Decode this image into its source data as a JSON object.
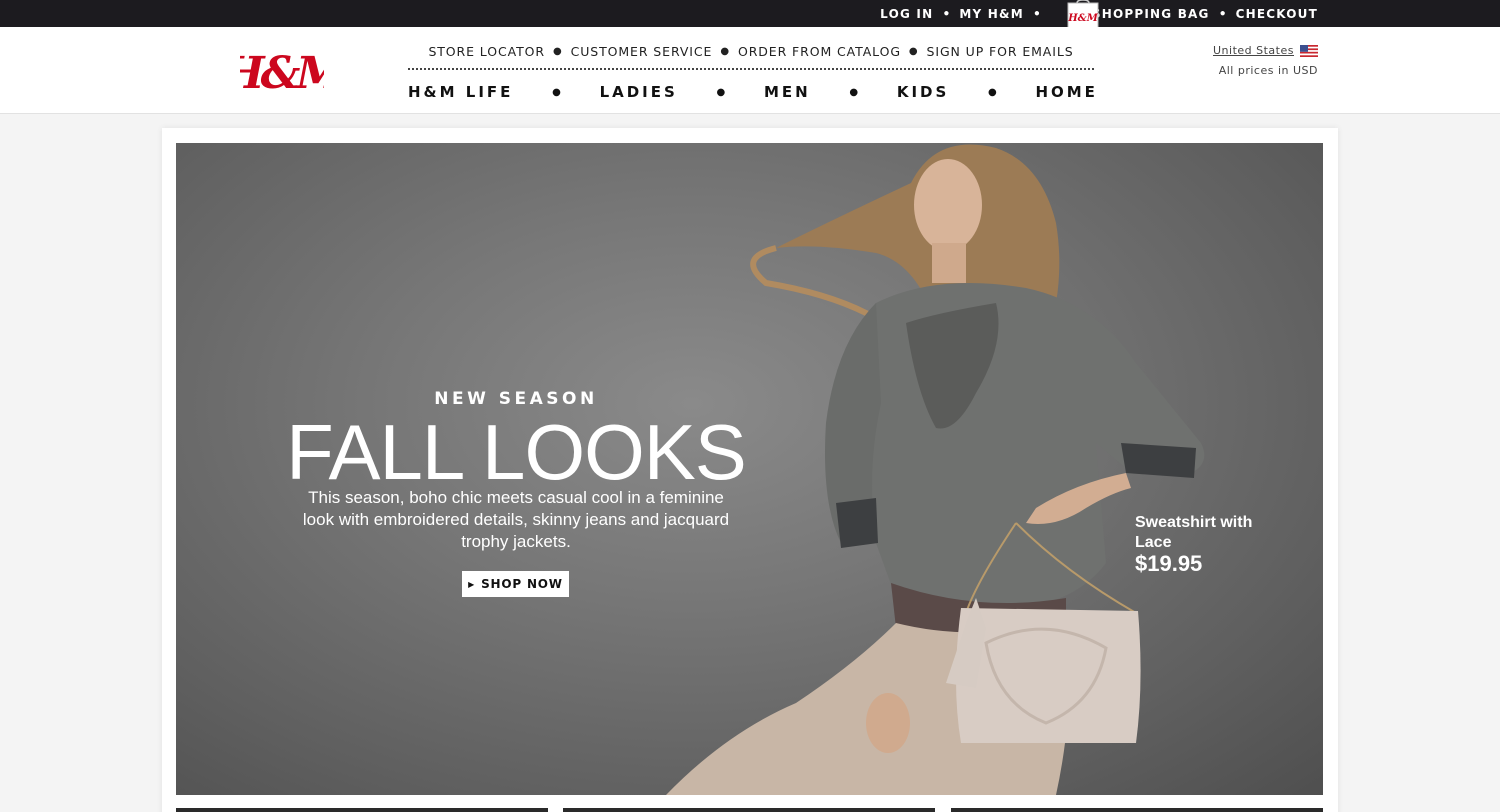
{
  "topbar": {
    "login": "LOG IN",
    "my_hm": "MY H&M",
    "bag_logo": "H&M",
    "shopping_bag": "SHOPPING BAG",
    "checkout": "CHECKOUT"
  },
  "brand": {
    "logo_text": "H&M",
    "logo_color": "#cc071e"
  },
  "util_nav": [
    "STORE LOCATOR",
    "CUSTOMER SERVICE",
    "ORDER FROM CATALOG",
    "SIGN UP FOR EMAILS"
  ],
  "main_nav": [
    "H&M LIFE",
    "LADIES",
    "MEN",
    "KIDS",
    "HOME"
  ],
  "region": {
    "country": "United States",
    "prices_note": "All prices in USD"
  },
  "hero": {
    "kicker": "NEW SEASON",
    "title": "FALL LOOKS",
    "description": "This season, boho chic meets casual cool in a feminine look with embroidered details, skinny jeans and jacquard trophy jackets.",
    "cta": "SHOP NOW",
    "product_name": "Sweatshirt with Lace",
    "product_price": "$19.95"
  },
  "icons": {
    "bag": "shopping-bag-icon",
    "flag": "us-flag-icon",
    "cta_arrow": "triangle-right-icon"
  }
}
